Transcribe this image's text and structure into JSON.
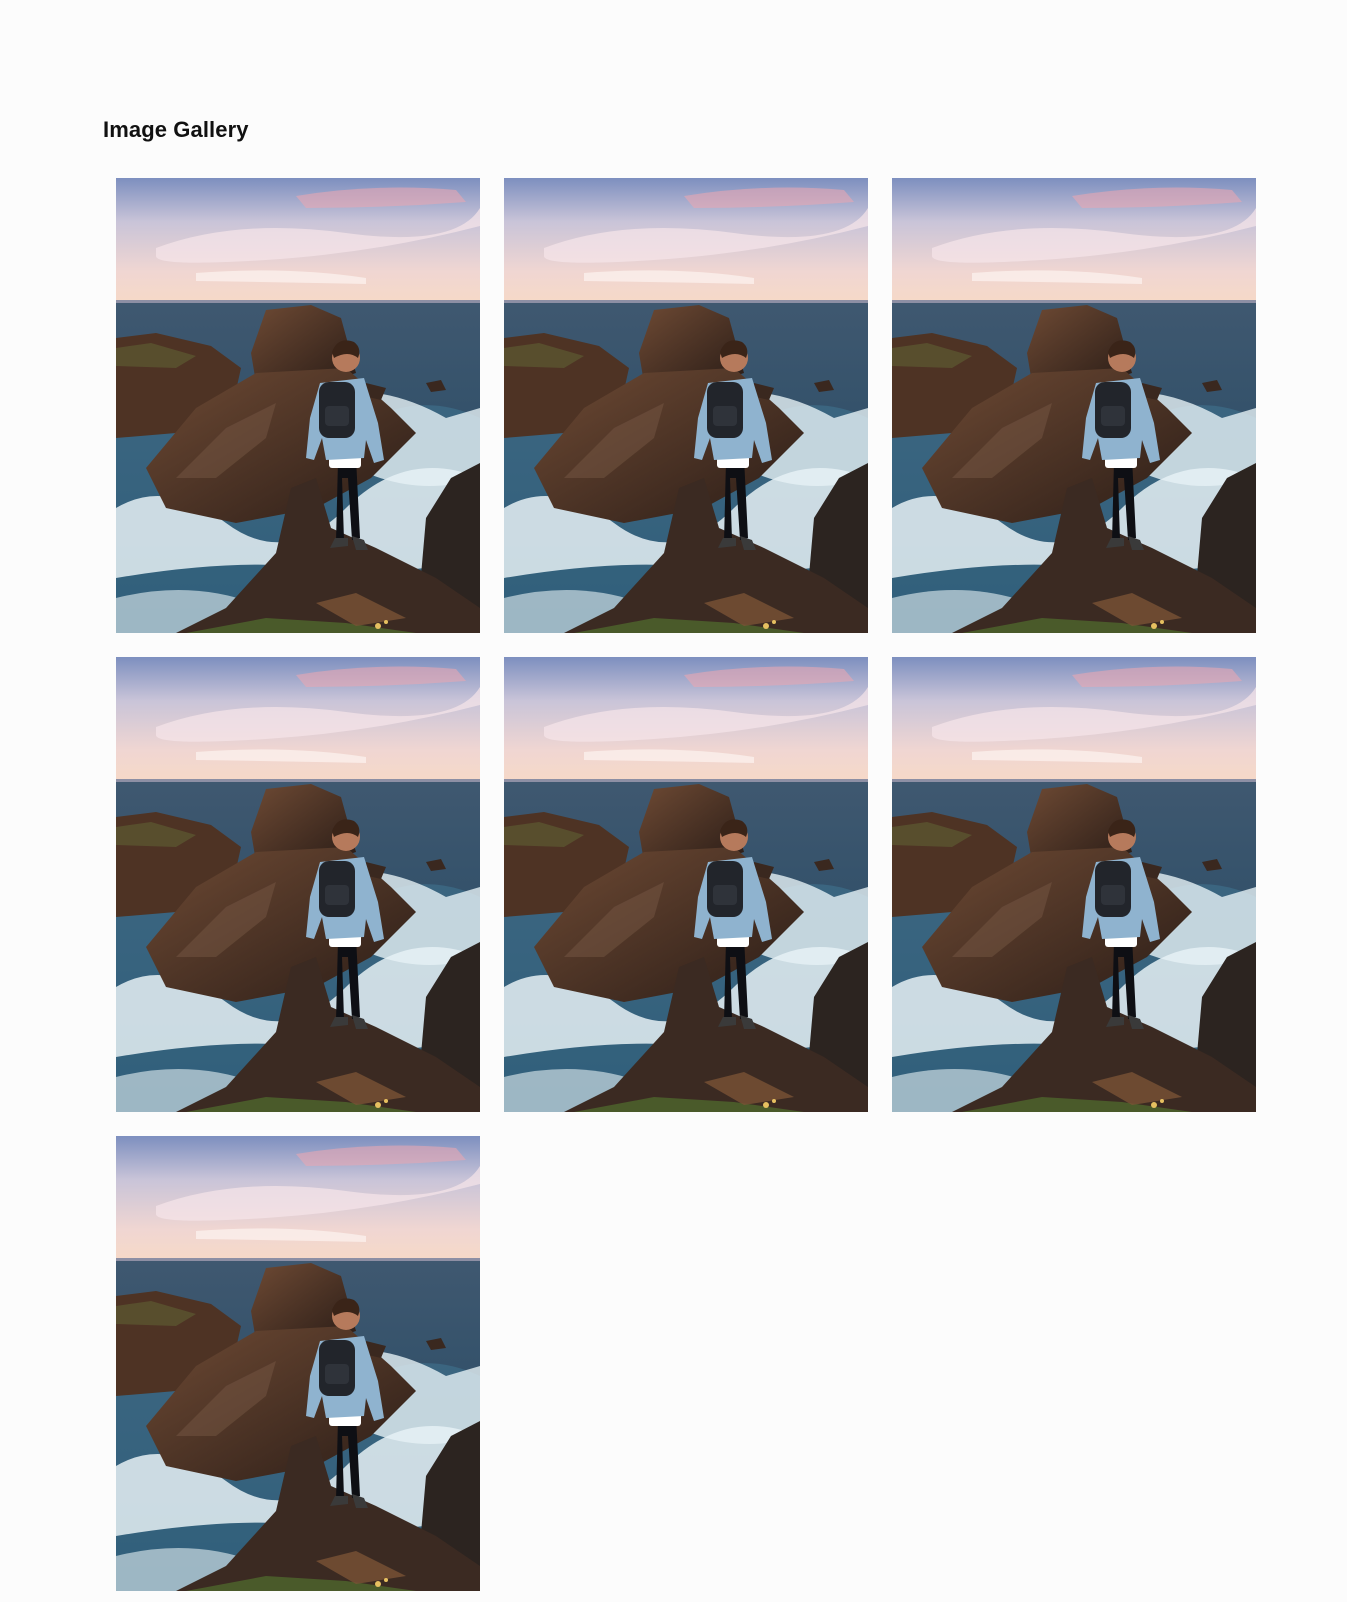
{
  "page": {
    "title": "Image Gallery"
  },
  "gallery": {
    "items": [
      {
        "name": "gallery-photo-1"
      },
      {
        "name": "gallery-photo-2"
      },
      {
        "name": "gallery-photo-3"
      },
      {
        "name": "gallery-photo-4"
      },
      {
        "name": "gallery-photo-5"
      },
      {
        "name": "gallery-photo-6"
      },
      {
        "name": "gallery-photo-7"
      }
    ],
    "photo_subject": "hiker-on-sea-cliff-photo"
  },
  "colors": {
    "background": "#fcfcfc",
    "title": "#111111",
    "sky_top": "#7d8fbf",
    "sky_warm": "#f3cfc6",
    "sea": "#2d4a60",
    "foam": "#dfeef3",
    "rock": "#4a3226",
    "jacket": "#8fb3cf"
  }
}
